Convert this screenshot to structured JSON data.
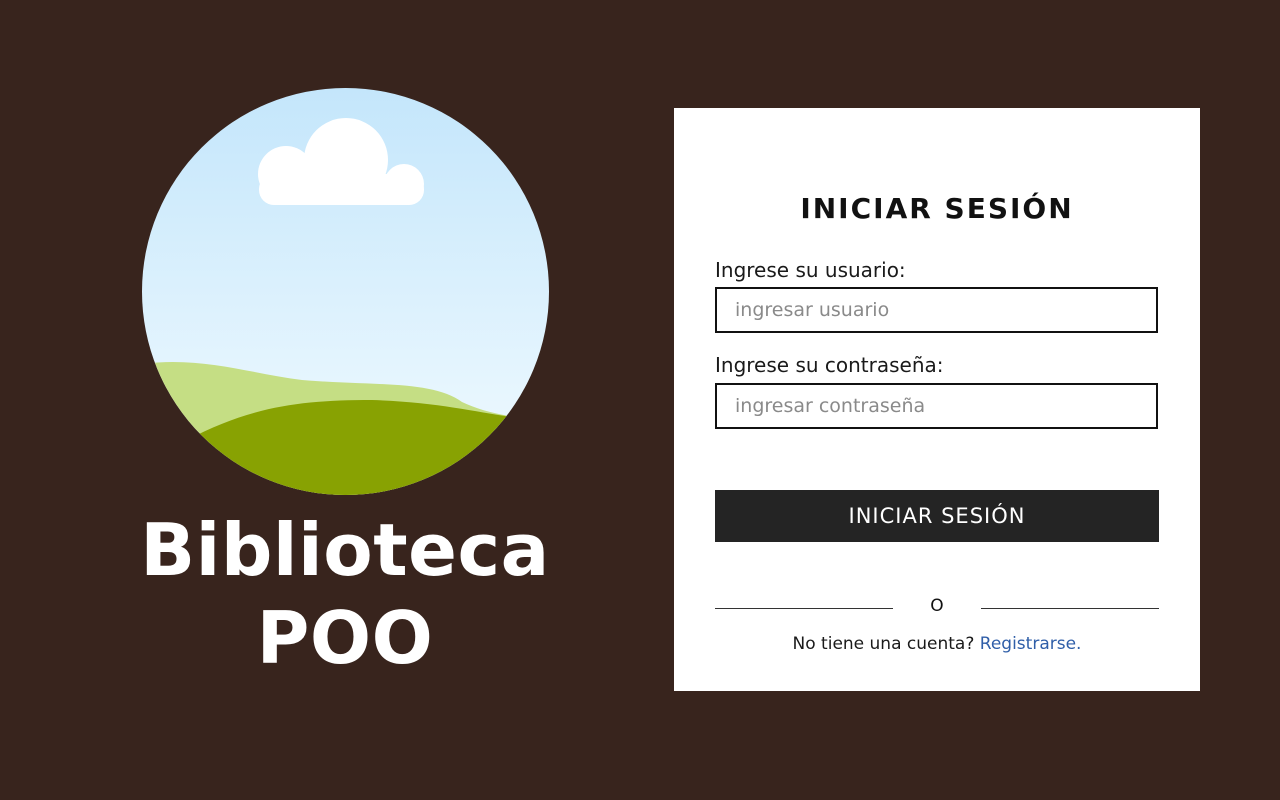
{
  "brand": {
    "title_line1": "Biblioteca",
    "title_line2": "POO",
    "logo_icon": "landscape-icon"
  },
  "login": {
    "heading": "INICIAR SESIÓN",
    "username_label": "Ingrese su usuario:",
    "username_placeholder": "ingresar usuario",
    "password_label": "Ingrese su contraseña:",
    "password_placeholder": "ingresar contraseña",
    "submit_label": "INICIAR SESIÓN",
    "divider_text": "O",
    "signup_prompt": "No tiene una cuenta?",
    "signup_link": "Registrarse."
  },
  "colors": {
    "background": "#38241d",
    "card": "#ffffff",
    "button": "#242424",
    "link": "#2f5ea8"
  }
}
